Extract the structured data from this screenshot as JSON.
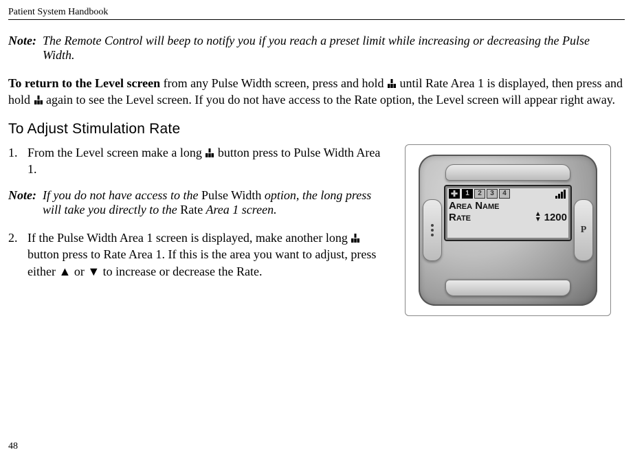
{
  "header": {
    "title": "Patient System Handbook"
  },
  "note1": {
    "label": "Note:",
    "text": "The Remote Control will beep to notify you if you reach a preset limit while increasing or decreasing the Pulse Width."
  },
  "return_para": {
    "lead": "To return to the Level screen",
    "tail1": " from any Pulse Width screen, press and hold ",
    "tail2": " until Rate Area 1 is displayed, then press and hold ",
    "tail3": " again to see the Level screen. If you do not have access to the Rate option, the Level screen will appear right away."
  },
  "section_title": "To Adjust Stimulation Rate",
  "step1": {
    "a": "From the Level screen make a long ",
    "b": " button press to Pulse Width Area 1."
  },
  "note2": {
    "label": "Note:",
    "pre": "If you do not have access to the ",
    "pw": "Pulse Width",
    "mid": " option, the long press will take you directly to the ",
    "rate": "Rate",
    "post": " Area 1 screen."
  },
  "step2": {
    "a": "If the Pulse Width Area 1 screen is displayed, make another long ",
    "b": " button press to Rate Area 1. If this is the area you want to adjust, press either ",
    "up": "▲",
    "mid": " or ",
    "down": "▼",
    "c": " to increase or decrease the Rate."
  },
  "device": {
    "tabs": [
      "1",
      "2",
      "3",
      "4"
    ],
    "line_area": "Area Name",
    "line_rate_label": "Rate",
    "line_rate_value": "1200",
    "right_btn": "P"
  },
  "page_number": "48"
}
